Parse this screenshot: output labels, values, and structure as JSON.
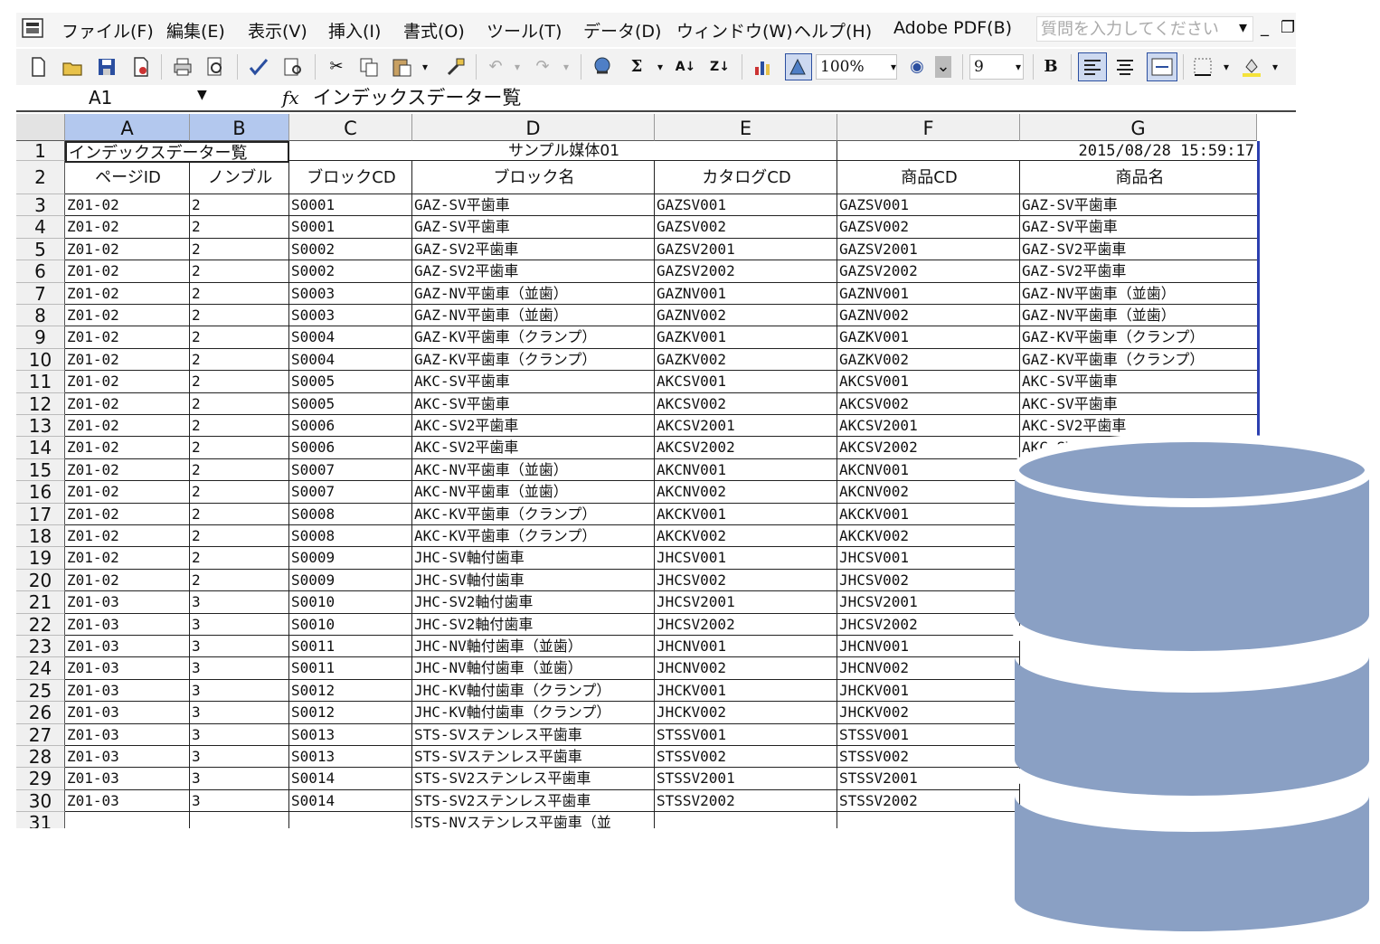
{
  "menu": [
    "ファイル(F)",
    "編集(E)",
    "表示(V)",
    "挿入(I)",
    "書式(O)",
    "ツール(T)",
    "データ(D)",
    "ウィンドウ(W)",
    "ヘルプ(H)",
    "Adobe PDF(B)"
  ],
  "help_placeholder": "質問を入力してください",
  "toolbar": {
    "zoom": "100%",
    "font_size": "9",
    "bold": "B"
  },
  "name_box": "A1",
  "fx_label": "fx",
  "formula": "インデックスデーター覧",
  "columns": [
    "A",
    "B",
    "C",
    "D",
    "E",
    "F",
    "G"
  ],
  "selected_columns": [
    "A",
    "B"
  ],
  "title_row": {
    "a1": "インデックスデーター覧",
    "center": "サンプル媒体01",
    "date": "2015/08/28 15:59:17"
  },
  "headers": [
    "ページID",
    "ノンブル",
    "ブロックCD",
    "ブロック名",
    "カタログCD",
    "商品CD",
    "商品名"
  ],
  "rows": [
    [
      "Z01-02",
      "2",
      "S0001",
      "GAZ-SV平歯車",
      "GAZSV001",
      "GAZSV001",
      "GAZ-SV平歯車"
    ],
    [
      "Z01-02",
      "2",
      "S0001",
      "GAZ-SV平歯車",
      "GAZSV002",
      "GAZSV002",
      "GAZ-SV平歯車"
    ],
    [
      "Z01-02",
      "2",
      "S0002",
      "GAZ-SV2平歯車",
      "GAZSV2001",
      "GAZSV2001",
      "GAZ-SV2平歯車"
    ],
    [
      "Z01-02",
      "2",
      "S0002",
      "GAZ-SV2平歯車",
      "GAZSV2002",
      "GAZSV2002",
      "GAZ-SV2平歯車"
    ],
    [
      "Z01-02",
      "2",
      "S0003",
      "GAZ-NV平歯車（並歯）",
      "GAZNV001",
      "GAZNV001",
      "GAZ-NV平歯車（並歯）"
    ],
    [
      "Z01-02",
      "2",
      "S0003",
      "GAZ-NV平歯車（並歯）",
      "GAZNV002",
      "GAZNV002",
      "GAZ-NV平歯車（並歯）"
    ],
    [
      "Z01-02",
      "2",
      "S0004",
      "GAZ-KV平歯車（クランプ）",
      "GAZKV001",
      "GAZKV001",
      "GAZ-KV平歯車（クランプ）"
    ],
    [
      "Z01-02",
      "2",
      "S0004",
      "GAZ-KV平歯車（クランプ）",
      "GAZKV002",
      "GAZKV002",
      "GAZ-KV平歯車（クランプ）"
    ],
    [
      "Z01-02",
      "2",
      "S0005",
      "AKC-SV平歯車",
      "AKCSV001",
      "AKCSV001",
      "AKC-SV平歯車"
    ],
    [
      "Z01-02",
      "2",
      "S0005",
      "AKC-SV平歯車",
      "AKCSV002",
      "AKCSV002",
      "AKC-SV平歯車"
    ],
    [
      "Z01-02",
      "2",
      "S0006",
      "AKC-SV2平歯車",
      "AKCSV2001",
      "AKCSV2001",
      "AKC-SV2平歯車"
    ],
    [
      "Z01-02",
      "2",
      "S0006",
      "AKC-SV2平歯車",
      "AKCSV2002",
      "AKCSV2002",
      "AKC-SV2平歯車"
    ],
    [
      "Z01-02",
      "2",
      "S0007",
      "AKC-NV平歯車（並歯）",
      "AKCNV001",
      "AKCNV001",
      ""
    ],
    [
      "Z01-02",
      "2",
      "S0007",
      "AKC-NV平歯車（並歯）",
      "AKCNV002",
      "AKCNV002",
      ""
    ],
    [
      "Z01-02",
      "2",
      "S0008",
      "AKC-KV平歯車（クランプ）",
      "AKCKV001",
      "AKCKV001",
      ""
    ],
    [
      "Z01-02",
      "2",
      "S0008",
      "AKC-KV平歯車（クランプ）",
      "AKCKV002",
      "AKCKV002",
      ""
    ],
    [
      "Z01-02",
      "2",
      "S0009",
      "JHC-SV軸付歯車",
      "JHCSV001",
      "JHCSV001",
      ""
    ],
    [
      "Z01-02",
      "2",
      "S0009",
      "JHC-SV軸付歯車",
      "JHCSV002",
      "JHCSV002",
      ""
    ],
    [
      "Z01-03",
      "3",
      "S0010",
      "JHC-SV2軸付歯車",
      "JHCSV2001",
      "JHCSV2001",
      ""
    ],
    [
      "Z01-03",
      "3",
      "S0010",
      "JHC-SV2軸付歯車",
      "JHCSV2002",
      "JHCSV2002",
      ""
    ],
    [
      "Z01-03",
      "3",
      "S0011",
      "JHC-NV軸付歯車（並歯）",
      "JHCNV001",
      "JHCNV001",
      ""
    ],
    [
      "Z01-03",
      "3",
      "S0011",
      "JHC-NV軸付歯車（並歯）",
      "JHCNV002",
      "JHCNV002",
      ""
    ],
    [
      "Z01-03",
      "3",
      "S0012",
      "JHC-KV軸付歯車（クランプ）",
      "JHCKV001",
      "JHCKV001",
      ""
    ],
    [
      "Z01-03",
      "3",
      "S0012",
      "JHC-KV軸付歯車（クランプ）",
      "JHCKV002",
      "JHCKV002",
      ""
    ],
    [
      "Z01-03",
      "3",
      "S0013",
      "STS-SVステンレス平歯車",
      "STSSV001",
      "STSSV001",
      ""
    ],
    [
      "Z01-03",
      "3",
      "S0013",
      "STS-SVステンレス平歯車",
      "STSSV002",
      "STSSV002",
      ""
    ],
    [
      "Z01-03",
      "3",
      "S0014",
      "STS-SV2ステンレス平歯車",
      "STSSV2001",
      "STSSV2001",
      ""
    ],
    [
      "Z01-03",
      "3",
      "S0014",
      "STS-SV2ステンレス平歯車",
      "STSSV2002",
      "STSSV2002",
      ""
    ],
    [
      "",
      "",
      "",
      "STS-NVステンレス平歯車（並",
      "",
      "",
      ""
    ]
  ],
  "colors": {
    "db_fill": "#8aa0c4",
    "selection": "#2c3fb0",
    "header_bg": "#f0f0f0"
  },
  "icons": [
    "new-icon",
    "open-icon",
    "save-icon",
    "permission-icon",
    "print-icon",
    "preview-icon",
    "spell-icon",
    "research-icon",
    "cut-icon",
    "copy-icon",
    "paste-icon",
    "format-painter-icon",
    "undo-icon",
    "redo-icon",
    "hyperlink-icon",
    "autosum-icon",
    "sort-asc-icon",
    "sort-desc-icon",
    "chart-icon",
    "drawing-icon",
    "help-icon",
    "database-icon"
  ]
}
